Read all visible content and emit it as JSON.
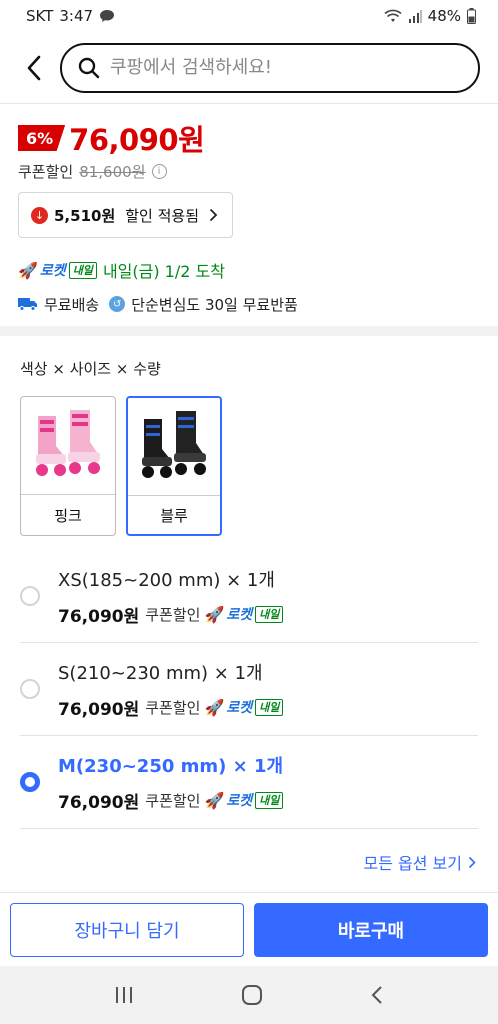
{
  "status": {
    "carrier": "SKT",
    "time": "3:47",
    "battery": "48%"
  },
  "search": {
    "placeholder": "쿠팡에서 검색하세요!"
  },
  "price": {
    "discount": "6%",
    "sale": "76,090원",
    "coupon_label": "쿠폰할인",
    "original": "81,600원",
    "apply_amount": "5,510원",
    "apply_label": "할인 적용됨"
  },
  "delivery": {
    "rocket": "로켓",
    "tag": "내일",
    "arrival": "내일(금) 1/2 도착",
    "free_ship": "무료배송",
    "free_return": "단순변심도 30일 무료반품"
  },
  "options": {
    "title": "색상 × 사이즈 × 수량",
    "colors": [
      {
        "label": "핑크",
        "selected": false
      },
      {
        "label": "블루",
        "selected": true
      }
    ],
    "sizes": [
      {
        "name": "XS(185~200 mm) × 1개",
        "price": "76,090원",
        "coupon": "쿠폰할인",
        "selected": false
      },
      {
        "name": "S(210~230 mm) × 1개",
        "price": "76,090원",
        "coupon": "쿠폰할인",
        "selected": false
      },
      {
        "name": "M(230~250 mm) × 1개",
        "price": "76,090원",
        "coupon": "쿠폰할인",
        "selected": true
      }
    ],
    "all_options": "모든 옵션 보기"
  },
  "actions": {
    "cart": "장바구니 담기",
    "buy": "바로구매"
  },
  "colors": {
    "accent": "#346aff",
    "sale_red": "#d80000",
    "delivery_green": "#00891a"
  }
}
